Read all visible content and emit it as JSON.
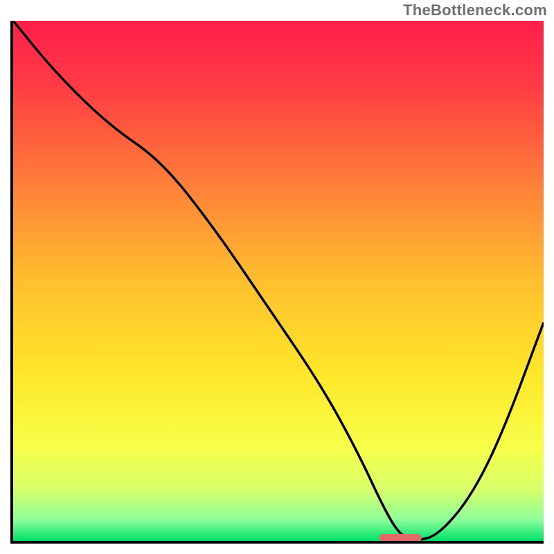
{
  "watermark": "TheBottleneck.com",
  "chart_data": {
    "type": "line",
    "title": "",
    "xlabel": "",
    "ylabel": "",
    "xlim": [
      0,
      100
    ],
    "ylim": [
      0,
      100
    ],
    "grid": false,
    "legend": false,
    "gradient_stops": [
      {
        "offset": 0.0,
        "color": "#ff1f4b"
      },
      {
        "offset": 0.12,
        "color": "#ff3a45"
      },
      {
        "offset": 0.3,
        "color": "#ff7a3a"
      },
      {
        "offset": 0.5,
        "color": "#ffbf2f"
      },
      {
        "offset": 0.68,
        "color": "#ffe72a"
      },
      {
        "offset": 0.82,
        "color": "#f7ff4a"
      },
      {
        "offset": 0.9,
        "color": "#d9ff6a"
      },
      {
        "offset": 0.96,
        "color": "#8cff9a"
      },
      {
        "offset": 1.0,
        "color": "#00e06a"
      }
    ],
    "curve": {
      "x": [
        0,
        8,
        18,
        28,
        38,
        48,
        58,
        65,
        70,
        73,
        76,
        80,
        86,
        92,
        100
      ],
      "y": [
        100,
        90,
        80,
        73,
        60,
        45,
        30,
        17,
        6,
        1,
        0,
        1,
        8,
        20,
        42
      ]
    },
    "marker": {
      "shape": "rounded-bar",
      "x_center": 73,
      "width": 8,
      "y": 0,
      "color": "#e06a6a"
    }
  }
}
